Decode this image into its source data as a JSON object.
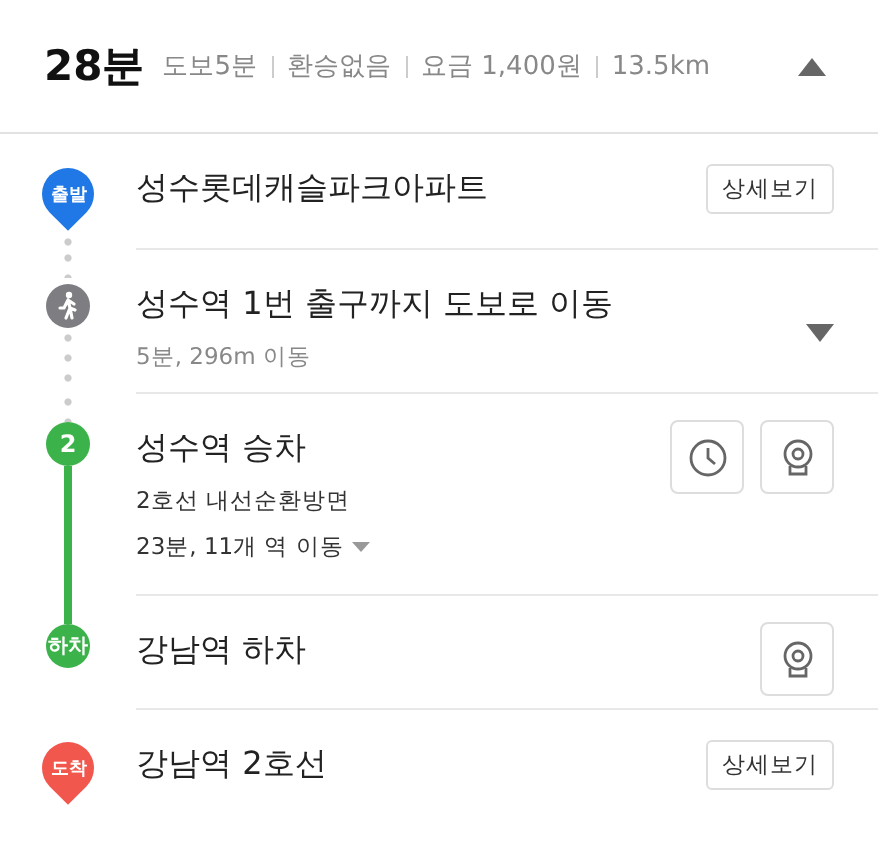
{
  "summary": {
    "duration": "28분",
    "facts": [
      "도보5분",
      "환승없음",
      "요금 1,400원",
      "13.5km"
    ],
    "expanded": true
  },
  "steps": [
    {
      "kind": "start",
      "badge": "출발",
      "title": "성수롯데캐슬파크아파트",
      "actions": [
        {
          "kind": "details",
          "label": "상세보기"
        }
      ]
    },
    {
      "kind": "walk",
      "title": "성수역 1번 출구까지 도보로 이동",
      "lines": [
        "5분, 296m 이동"
      ],
      "expanded": false
    },
    {
      "kind": "board",
      "badge": "2",
      "title": "성수역 승차",
      "lines": [
        "2호선 내선순환방면"
      ],
      "stops": {
        "text": "23분, 11개 역 이동",
        "expanded": false
      },
      "actions": [
        {
          "kind": "timetable"
        },
        {
          "kind": "cctv"
        }
      ]
    },
    {
      "kind": "alight",
      "badge": "하차",
      "title": "강남역 하차",
      "actions": [
        {
          "kind": "cctv"
        }
      ]
    },
    {
      "kind": "arrive",
      "badge": "도착",
      "title": "강남역 2호선",
      "actions": [
        {
          "kind": "details",
          "label": "상세보기"
        }
      ]
    }
  ]
}
